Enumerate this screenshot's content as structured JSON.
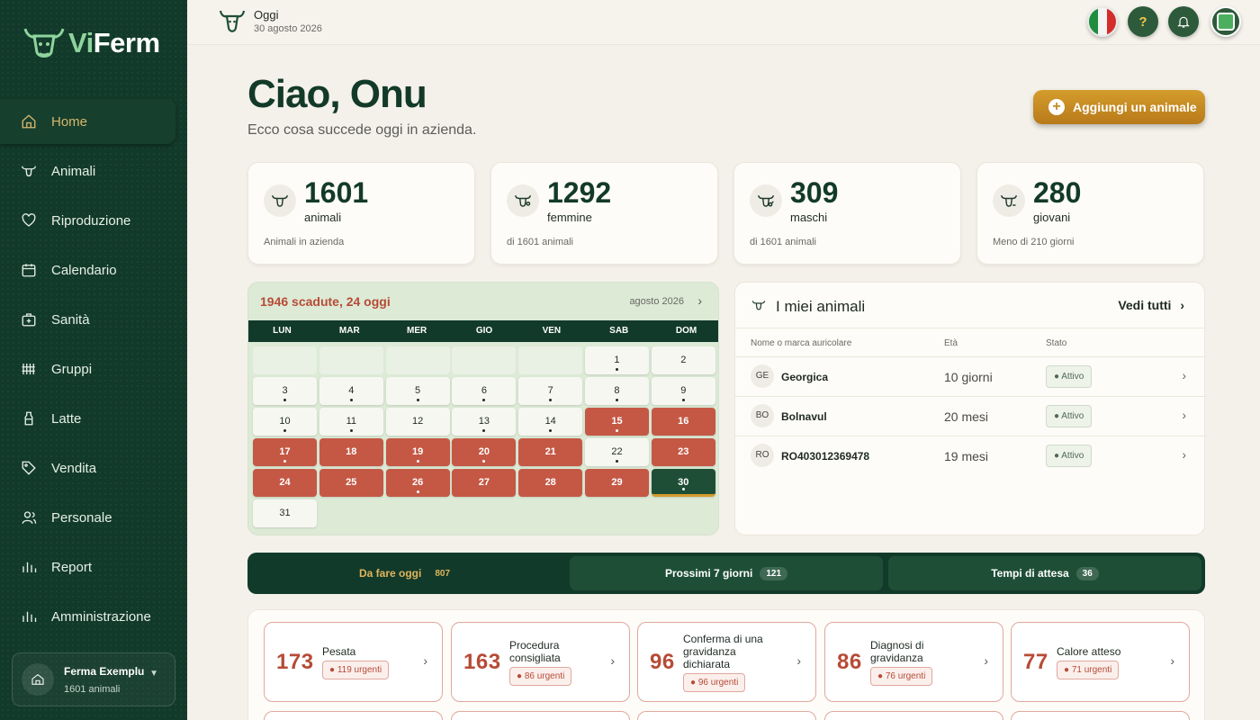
{
  "app": {
    "logo_prefix": "Vi",
    "logo_suffix": "Ferm"
  },
  "sidebar": {
    "items": [
      {
        "label": "Home",
        "icon": "home-icon"
      },
      {
        "label": "Animali",
        "icon": "cow-icon"
      },
      {
        "label": "Riproduzione",
        "icon": "heart-icon"
      },
      {
        "label": "Calendario",
        "icon": "calendar-icon"
      },
      {
        "label": "Sanità",
        "icon": "medical-icon"
      },
      {
        "label": "Gruppi",
        "icon": "fence-icon"
      },
      {
        "label": "Latte",
        "icon": "milk-bottle-icon"
      },
      {
        "label": "Vendita",
        "icon": "tag-icon"
      },
      {
        "label": "Personale",
        "icon": "people-icon"
      },
      {
        "label": "Report",
        "icon": "chart-icon"
      },
      {
        "label": "Amministrazione",
        "icon": "chart-icon"
      }
    ],
    "farm": {
      "name": "Ferma Exemplu",
      "animals": "1601 animali"
    }
  },
  "header": {
    "today_label": "Oggi",
    "today_date": "30 agosto 2026",
    "help": "?"
  },
  "greeting": {
    "title": "Ciao, Onu",
    "subtitle": "Ecco cosa succede oggi in azienda.",
    "add_button": "Aggiungi un animale"
  },
  "stats": [
    {
      "value": "1601",
      "label": "animali",
      "sub": "Animali in azienda"
    },
    {
      "value": "1292",
      "label": "femmine",
      "sub": "di 1601 animali"
    },
    {
      "value": "309",
      "label": "maschi",
      "sub": "di 1601 animali"
    },
    {
      "value": "280",
      "label": "giovani",
      "sub": "Meno di 210 giorni"
    }
  ],
  "calendar": {
    "alert": "1946 scadute, 24 oggi",
    "month": "agosto 2026",
    "weekdays": [
      "LUN",
      "MAR",
      "MER",
      "GIO",
      "VEN",
      "SAB",
      "DOM"
    ],
    "leading_blanks": 5,
    "red_days": [
      15,
      16,
      17,
      18,
      19,
      20,
      21,
      23,
      24,
      25,
      26,
      27,
      28,
      29
    ],
    "today": 30,
    "dot_days": [
      1,
      3,
      4,
      5,
      6,
      7,
      8,
      9,
      10,
      11,
      13,
      14,
      15,
      17,
      19,
      20,
      22,
      26,
      30
    ],
    "days_in_month": 31
  },
  "animals": {
    "title": "I miei animali",
    "see_all": "Vedi tutti",
    "columns": [
      "Nome o marca auricolare",
      "Età",
      "Stato"
    ],
    "rows": [
      {
        "initials": "GE",
        "name": "Georgica",
        "age": "10 giorni",
        "status": "● Attivo"
      },
      {
        "initials": "BO",
        "name": "Bolnavul",
        "age": "20 mesi",
        "status": "● Attivo"
      },
      {
        "initials": "RO",
        "name": "RO403012369478",
        "age": "19 mesi",
        "status": "● Attivo"
      }
    ]
  },
  "tabs": [
    {
      "label": "Da fare oggi",
      "count": "807"
    },
    {
      "label": "Prossimi 7 giorni",
      "count": "121"
    },
    {
      "label": "Tempi di attesa",
      "count": "36"
    }
  ],
  "tasks": [
    {
      "count": "173",
      "title": "Pesata",
      "urgent": "● 119 urgenti"
    },
    {
      "count": "163",
      "title": "Procedura consigliata",
      "urgent": "● 86 urgenti"
    },
    {
      "count": "96",
      "title": "Conferma di una gravidanza dichiarata",
      "urgent": "● 96 urgenti"
    },
    {
      "count": "86",
      "title": "Diagnosi di gravidanza",
      "urgent": "● 76 urgenti"
    },
    {
      "count": "77",
      "title": "Calore atteso",
      "urgent": "● 71 urgenti"
    }
  ],
  "colors": {
    "sidebar": "#123a2a",
    "accent_gold": "#d49c2c",
    "alert_red": "#c45845",
    "primary_green": "#133a28"
  }
}
